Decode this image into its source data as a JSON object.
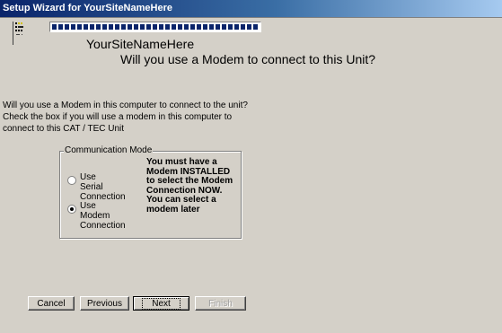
{
  "window": {
    "title": "Setup Wizard for YourSiteNameHere"
  },
  "header": {
    "logo_icon": "app-logo-icon",
    "progress_percent": 100,
    "site_name": "YourSiteNameHere",
    "question": "Will you use a Modem to connect to this Unit?"
  },
  "description": "Will you use a Modem in this computer to connect to the unit?  Check the box if you will  use a modem in this computer to connect to this CAT / TEC Unit",
  "communication_mode": {
    "legend": "Communication Mode",
    "options": [
      {
        "label": "Use Serial Connection",
        "selected": false
      },
      {
        "label": "Use Modem Connection",
        "selected": true
      }
    ],
    "note": "You must have a Modem INSTALLED to select the Modem Connection NOW.  You can select a modem later"
  },
  "buttons": {
    "cancel": "Cancel",
    "previous": "Previous",
    "next": "Next",
    "finish": "Finish"
  }
}
